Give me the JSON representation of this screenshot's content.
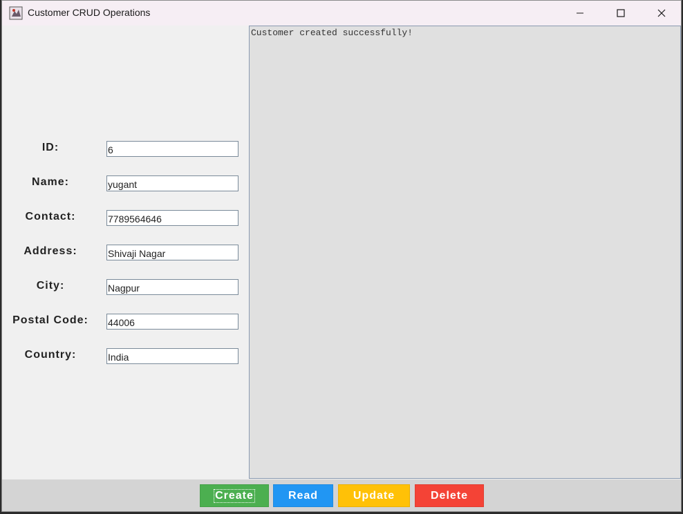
{
  "window": {
    "title": "Customer CRUD Operations",
    "app_icon": "java-app-icon",
    "controls": {
      "minimize_icon": "minimize-icon",
      "maximize_icon": "maximize-icon",
      "close_icon": "close-icon"
    }
  },
  "form": {
    "fields": [
      {
        "label": "ID:",
        "value": "6"
      },
      {
        "label": "Name:",
        "value": "yugant"
      },
      {
        "label": "Contact:",
        "value": "7789564646"
      },
      {
        "label": "Address:",
        "value": "Shivaji Nagar"
      },
      {
        "label": "City:",
        "value": "Nagpur"
      },
      {
        "label": "Postal Code:",
        "value": "44006"
      },
      {
        "label": "Country:",
        "value": "India"
      }
    ]
  },
  "output": {
    "text": "Customer created successfully!"
  },
  "buttons": {
    "create": {
      "label": "Create",
      "color": "#4caf50"
    },
    "read": {
      "label": "Read",
      "color": "#2196f3"
    },
    "update": {
      "label": "Update",
      "color": "#ffc107"
    },
    "delete": {
      "label": "Delete",
      "color": "#f44336"
    }
  }
}
